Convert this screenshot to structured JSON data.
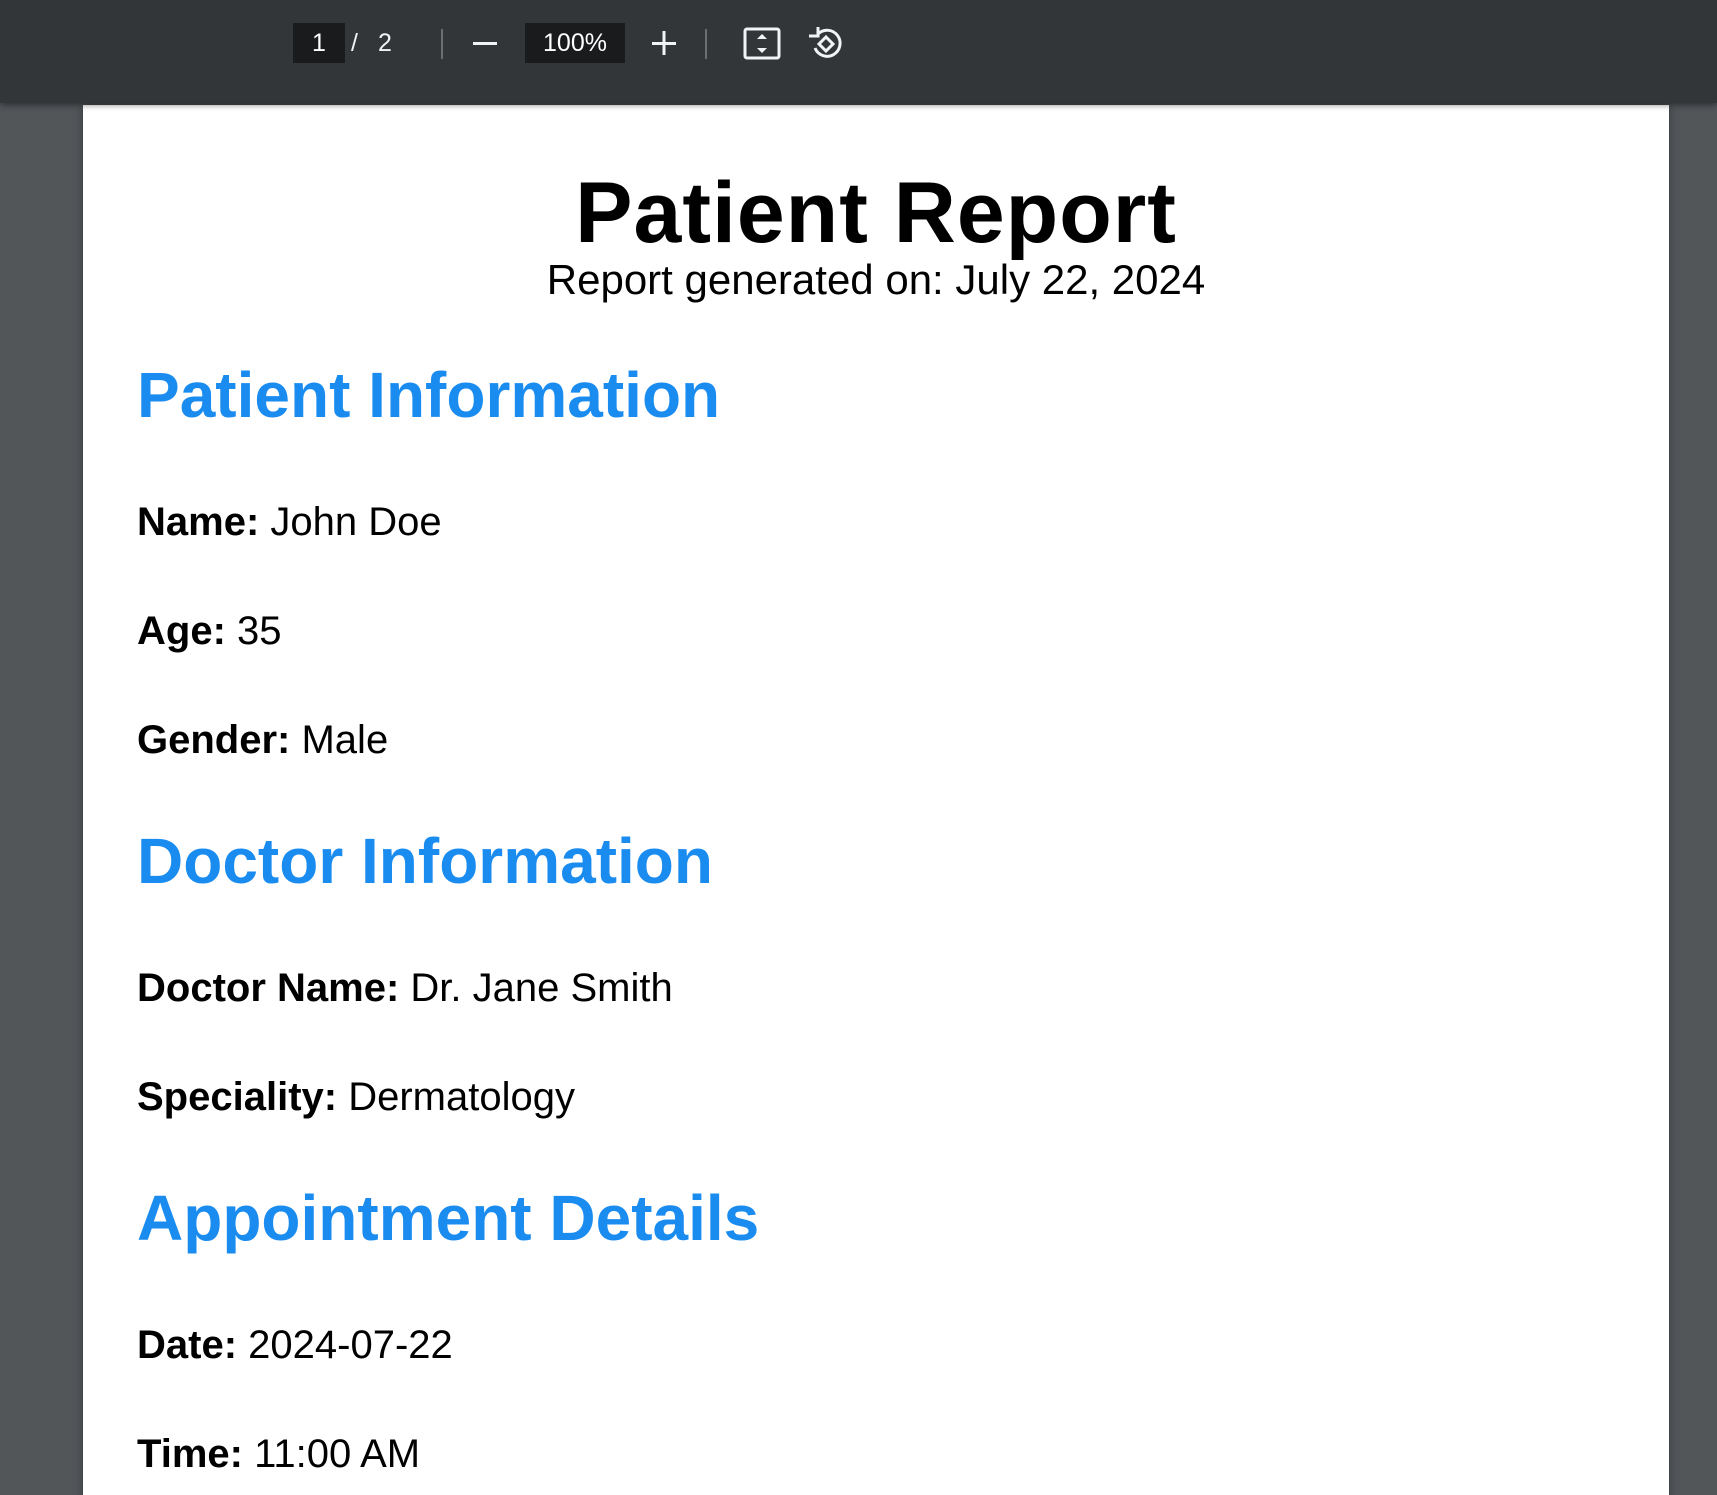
{
  "toolbar": {
    "current_page": "1",
    "page_separator": "/",
    "total_pages": "2",
    "zoom": "100%",
    "icons": {
      "zoom_out": "minus-icon",
      "zoom_in": "plus-icon",
      "fit": "fit-to-page-icon",
      "rotate": "rotate-counterclockwise-icon"
    }
  },
  "document": {
    "title": "Patient Report",
    "subtitle": "Report generated on: July 22, 2024",
    "sections": {
      "patient": {
        "heading": "Patient Information",
        "fields": [
          {
            "label": "Name:",
            "value": "John Doe"
          },
          {
            "label": "Age:",
            "value": "35"
          },
          {
            "label": "Gender:",
            "value": "Male"
          }
        ]
      },
      "doctor": {
        "heading": "Doctor Information",
        "fields": [
          {
            "label": "Doctor Name:",
            "value": "Dr. Jane Smith"
          },
          {
            "label": "Speciality:",
            "value": "Dermatology"
          }
        ]
      },
      "appointment": {
        "heading": "Appointment Details",
        "fields": [
          {
            "label": "Date:",
            "value": "2024-07-22"
          },
          {
            "label": "Time:",
            "value": "11:00 AM"
          }
        ]
      }
    }
  },
  "colors": {
    "toolbar_bg": "#323639",
    "viewer_bg": "#525659",
    "heading_blue": "#1a8cf0",
    "page_bg": "#ffffff"
  }
}
